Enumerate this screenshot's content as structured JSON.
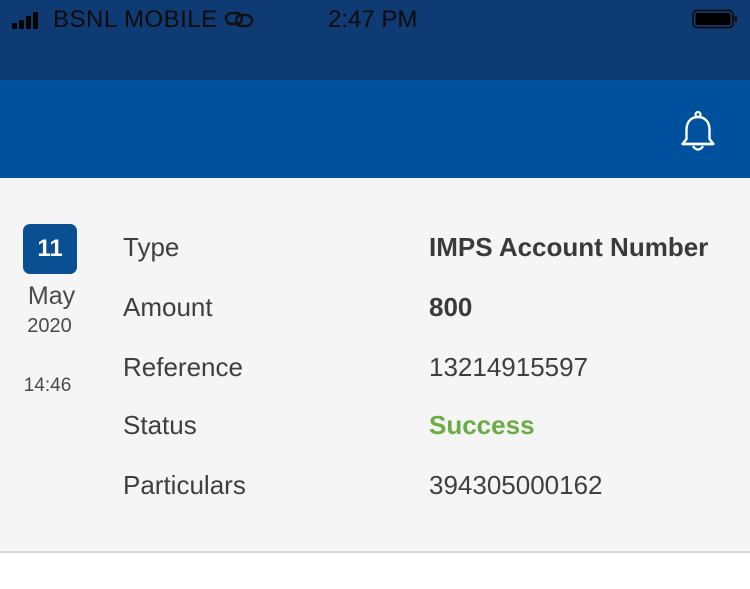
{
  "status_bar": {
    "carrier": "BSNL MOBILE",
    "time": "2:47 PM"
  },
  "app_bar": {
    "notification_icon": "bell-icon"
  },
  "transaction": {
    "date": {
      "day": "11",
      "month": "May",
      "year": "2020",
      "time": "14:46"
    },
    "rows": [
      {
        "label": "Type",
        "value": "IMPS Account Number"
      },
      {
        "label": "Amount",
        "value": "800"
      },
      {
        "label": "Reference",
        "value": "13214915597"
      },
      {
        "label": "Status",
        "value": "Success"
      },
      {
        "label": "Particulars",
        "value": "394305000162"
      }
    ]
  },
  "colors": {
    "status_bar_bg": "#0e3b73",
    "app_bar_bg": "#00519d",
    "date_badge_bg": "#0b4f93",
    "success": "#6aac45"
  }
}
